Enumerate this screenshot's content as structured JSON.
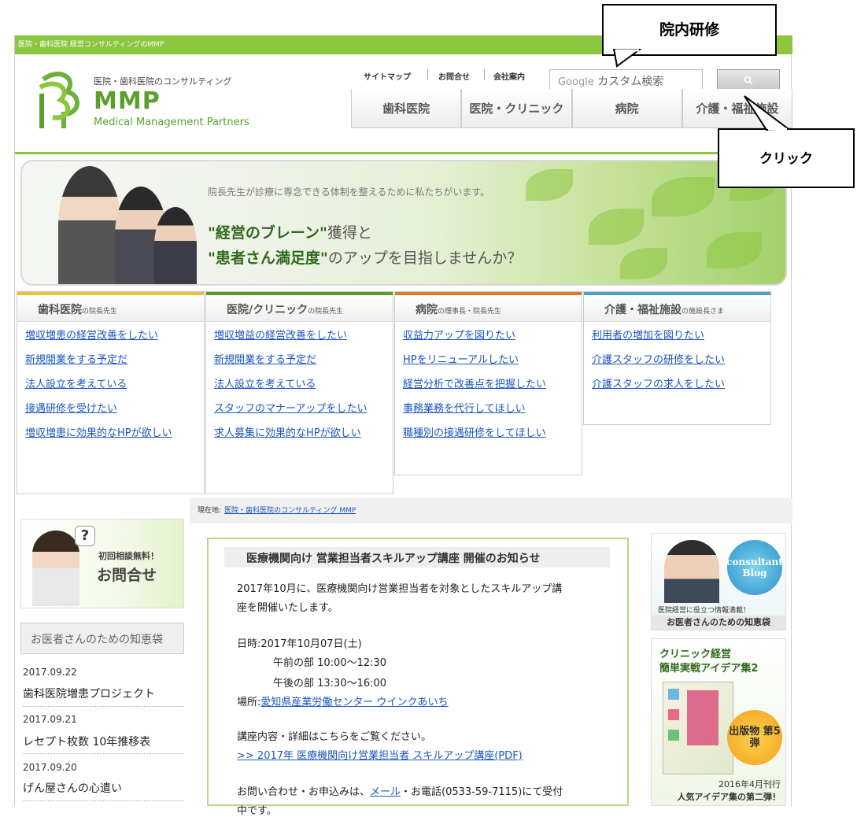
{
  "topbar": {
    "text": "医院・歯科医院 経営コンサルティングのMMP"
  },
  "logo": {
    "subtitle": "医院・歯科医院のコンサルティング",
    "name": "MMP",
    "english": "Medical Management Partners"
  },
  "utility_links": [
    "サイトマップ",
    "お問合せ",
    "会社案内"
  ],
  "search": {
    "brand": "Google",
    "placeholder": "カスタム検索"
  },
  "nav_tabs": [
    "歯科医院",
    "医院・クリニック",
    "病院",
    "介護・福祉施設"
  ],
  "hero": {
    "small": "院長先生が診療に専念できる体制を整えるために私たちがいます。",
    "line1_strong": "\"経営のブレーン\"",
    "line1_rest": "獲得と",
    "line2_strong": "\"患者さん満足度\"",
    "line2_rest": "のアップを目指しませんか？"
  },
  "categories": [
    {
      "title": "歯科医院",
      "suffix": "の院長先生",
      "color": "#e8c33a",
      "links": [
        "増収増患の経営改善をしたい",
        "新規開業をする予定だ",
        "法人設立を考えている",
        "接遇研修を受けたい",
        "増収増患に効果的なHPが欲しい"
      ]
    },
    {
      "title": "医院/クリニック",
      "suffix": "の院長先生",
      "color": "#5a9a2c",
      "links": [
        "増収増益の経営改善をしたい",
        "新規開業をする予定だ",
        "法人設立を考えている",
        "スタッフのマナーアップをしたい",
        "求人募集に効果的なHPが欲しい"
      ]
    },
    {
      "title": "病院",
      "suffix": "の理事長・院長先生",
      "color": "#e07a2a",
      "links": [
        "収益力アップを図りたい",
        "HPをリニューアルしたい",
        "経営分析で改善点を把握したい",
        "事務業務を代行してほしい",
        "職種別の接遇研修をしてほしい"
      ]
    },
    {
      "title": "介護・福祉施設",
      "suffix": "の施設長さま",
      "color": "#4aa0c8",
      "links": [
        "利用者の増加を図りたい",
        "介護スタッフの研修をしたい",
        "介護スタッフの求人をしたい"
      ]
    }
  ],
  "breadcrumb": {
    "label": "現在地:",
    "link": "医院・歯科医院のコンサルティング MMP"
  },
  "side_banner": {
    "small": "初回相談無料！",
    "big": "お問合せ"
  },
  "chie_box": "お医者さんのための知恵袋",
  "news": [
    {
      "date": "2017.09.22",
      "title": "歯科医院増患プロジェクト"
    },
    {
      "date": "2017.09.21",
      "title": "レセプト枚数 10年推移表"
    },
    {
      "date": "2017.09.20",
      "title": "げん屋さんの心遣い"
    }
  ],
  "article": {
    "title": "医療機関向け 営業担当者スキルアップ講座 開催のお知らせ",
    "intro1": "2017年10月に、医療機関向け営業担当者を対象としたスキルアップ講",
    "intro2": "座を開催いたします。",
    "date_line": "日時:2017年10月07日(土)",
    "morning": "午前の部  10:00〜12:30",
    "afternoon": "午後の部  13:30〜16:00",
    "place_label": "場所:",
    "place_link": "愛知県産業労働センター ウインクあいち",
    "detail": "講座内容・詳細はこちらをご覧ください。",
    "pdf_link": ">> 2017年 医療機関向け営業担当者 スキルアップ講座(PDF)",
    "contact_pre": "お問い合わせ・お申込みは、",
    "contact_link": "メール",
    "contact_post": "・お電話(0533-59-7115)にて受付",
    "contact_tail": "中です。"
  },
  "blog_card": {
    "badge": "consultant Blog",
    "caption": "医院経営に役立つ情報満載！",
    "footer": "お医者さんのための知恵袋"
  },
  "book_card": {
    "line1": "クリニック経営",
    "line2": "簡単実戦アイデア集2",
    "stamp": "出版物 第5弾",
    "date": "2016年4月刊行",
    "tag": "人気アイデア集の第二弾！"
  },
  "callouts": {
    "top": "院内研修",
    "bottom": "クリック"
  }
}
